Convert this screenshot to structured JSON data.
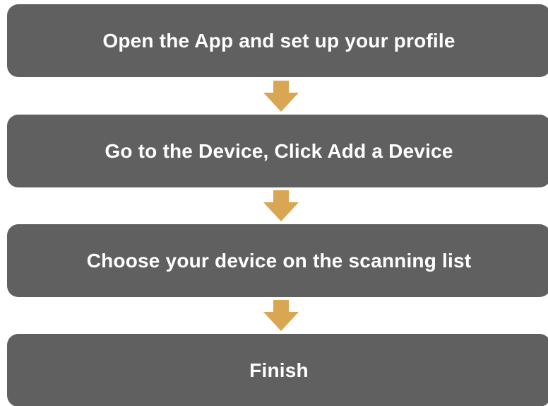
{
  "steps": [
    {
      "label": "Open the App and set up your profile"
    },
    {
      "label": "Go to the Device, Click Add a Device"
    },
    {
      "label": "Choose your device on the scanning list"
    },
    {
      "label": "Finish"
    }
  ],
  "colors": {
    "step_background": "#5f605f",
    "step_text": "#ffffff",
    "arrow": "#d9a653"
  },
  "icons": {
    "connector": "arrow-down-icon"
  }
}
